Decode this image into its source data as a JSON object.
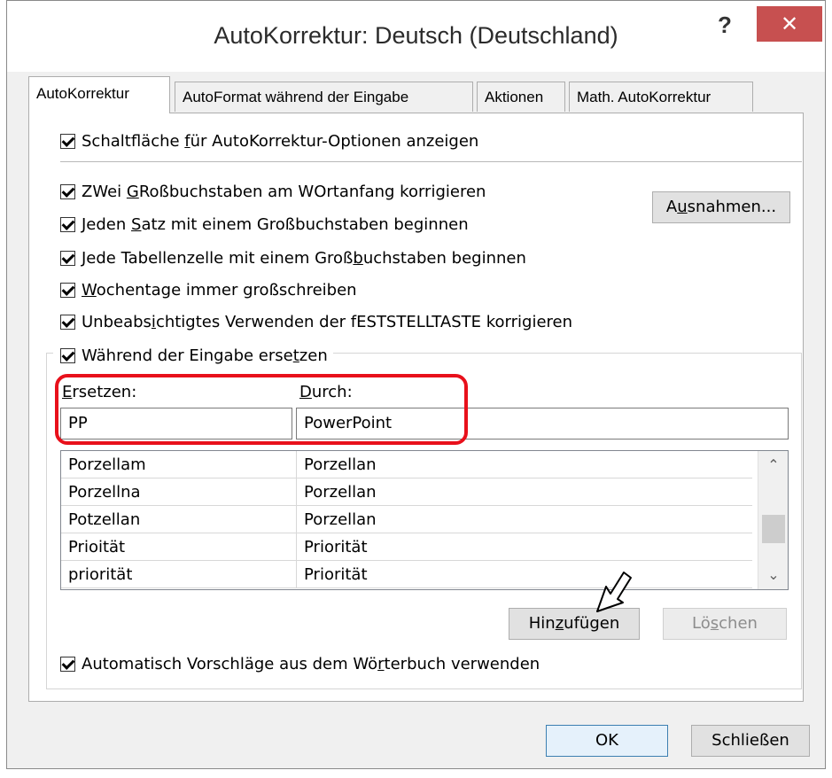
{
  "window": {
    "title": "AutoKorrektur: Deutsch (Deutschland)",
    "help_label": "?",
    "close_label": "✕"
  },
  "tabs": [
    {
      "label": "AutoKorrektur",
      "active": true
    },
    {
      "label": "AutoFormat während der Eingabe",
      "active": false
    },
    {
      "label": "Aktionen",
      "active": false
    },
    {
      "label": "Math. AutoKorrektur",
      "active": false
    }
  ],
  "options": {
    "show_options_buttons": {
      "pre": "Schaltfläche ",
      "key": "f",
      "post": "ür AutoKorrektur-Optionen anzeigen",
      "checked": true
    },
    "two_initial_caps": {
      "pre": "ZWei ",
      "key": "G",
      "post": "Roßbuchstaben am WOrtanfang korrigieren",
      "checked": true
    },
    "sentence_caps": {
      "pre": "Jeden ",
      "key": "S",
      "post": "atz mit einem Großbuchstaben beginnen",
      "checked": true
    },
    "table_cell_caps": {
      "pre": "Jede Tabellenzelle mit einem Groß",
      "key": "b",
      "post": "uchstaben beginnen",
      "checked": true
    },
    "weekday_caps": {
      "pre": "",
      "key": "W",
      "post": "ochentage immer großschreiben",
      "checked": true
    },
    "caps_lock": {
      "pre": "Unbeabs",
      "key": "i",
      "post": "chtigtes Verwenden der fESTSTELLTASTE korrigieren",
      "checked": true
    },
    "replace_while_typing": {
      "pre": "Während der Eingabe erse",
      "key": "t",
      "post": "zen",
      "checked": true
    },
    "dictionary_suggestions": {
      "pre": "Automatisch Vorschläge aus dem Wö",
      "key": "r",
      "post": "terbuch verwenden",
      "checked": true
    }
  },
  "buttons": {
    "exceptions": {
      "pre": "A",
      "key": "u",
      "post": "snahmen..."
    },
    "add": {
      "pre": "Hin",
      "key": "z",
      "post": "ufügen"
    },
    "delete": {
      "pre": "Lö",
      "key": "s",
      "post": "chen"
    },
    "ok": "OK",
    "close": "Schließen"
  },
  "replace": {
    "replace_label_key": "E",
    "replace_label_post": "rsetzen:",
    "with_label_key": "D",
    "with_label_post": "urch:",
    "replace_value": "PP",
    "with_value": "PowerPoint"
  },
  "list": {
    "rows": [
      {
        "replace": "Porzellam",
        "with": "Porzellan"
      },
      {
        "replace": "Porzellna",
        "with": "Porzellan"
      },
      {
        "replace": "Potzellan",
        "with": "Porzellan"
      },
      {
        "replace": "Prioität",
        "with": "Priorität"
      },
      {
        "replace": "priorität",
        "with": "Priorität"
      }
    ],
    "scroll_position": 0.45
  },
  "colors": {
    "highlight": "#e8101b",
    "close_button": "#c75050"
  }
}
